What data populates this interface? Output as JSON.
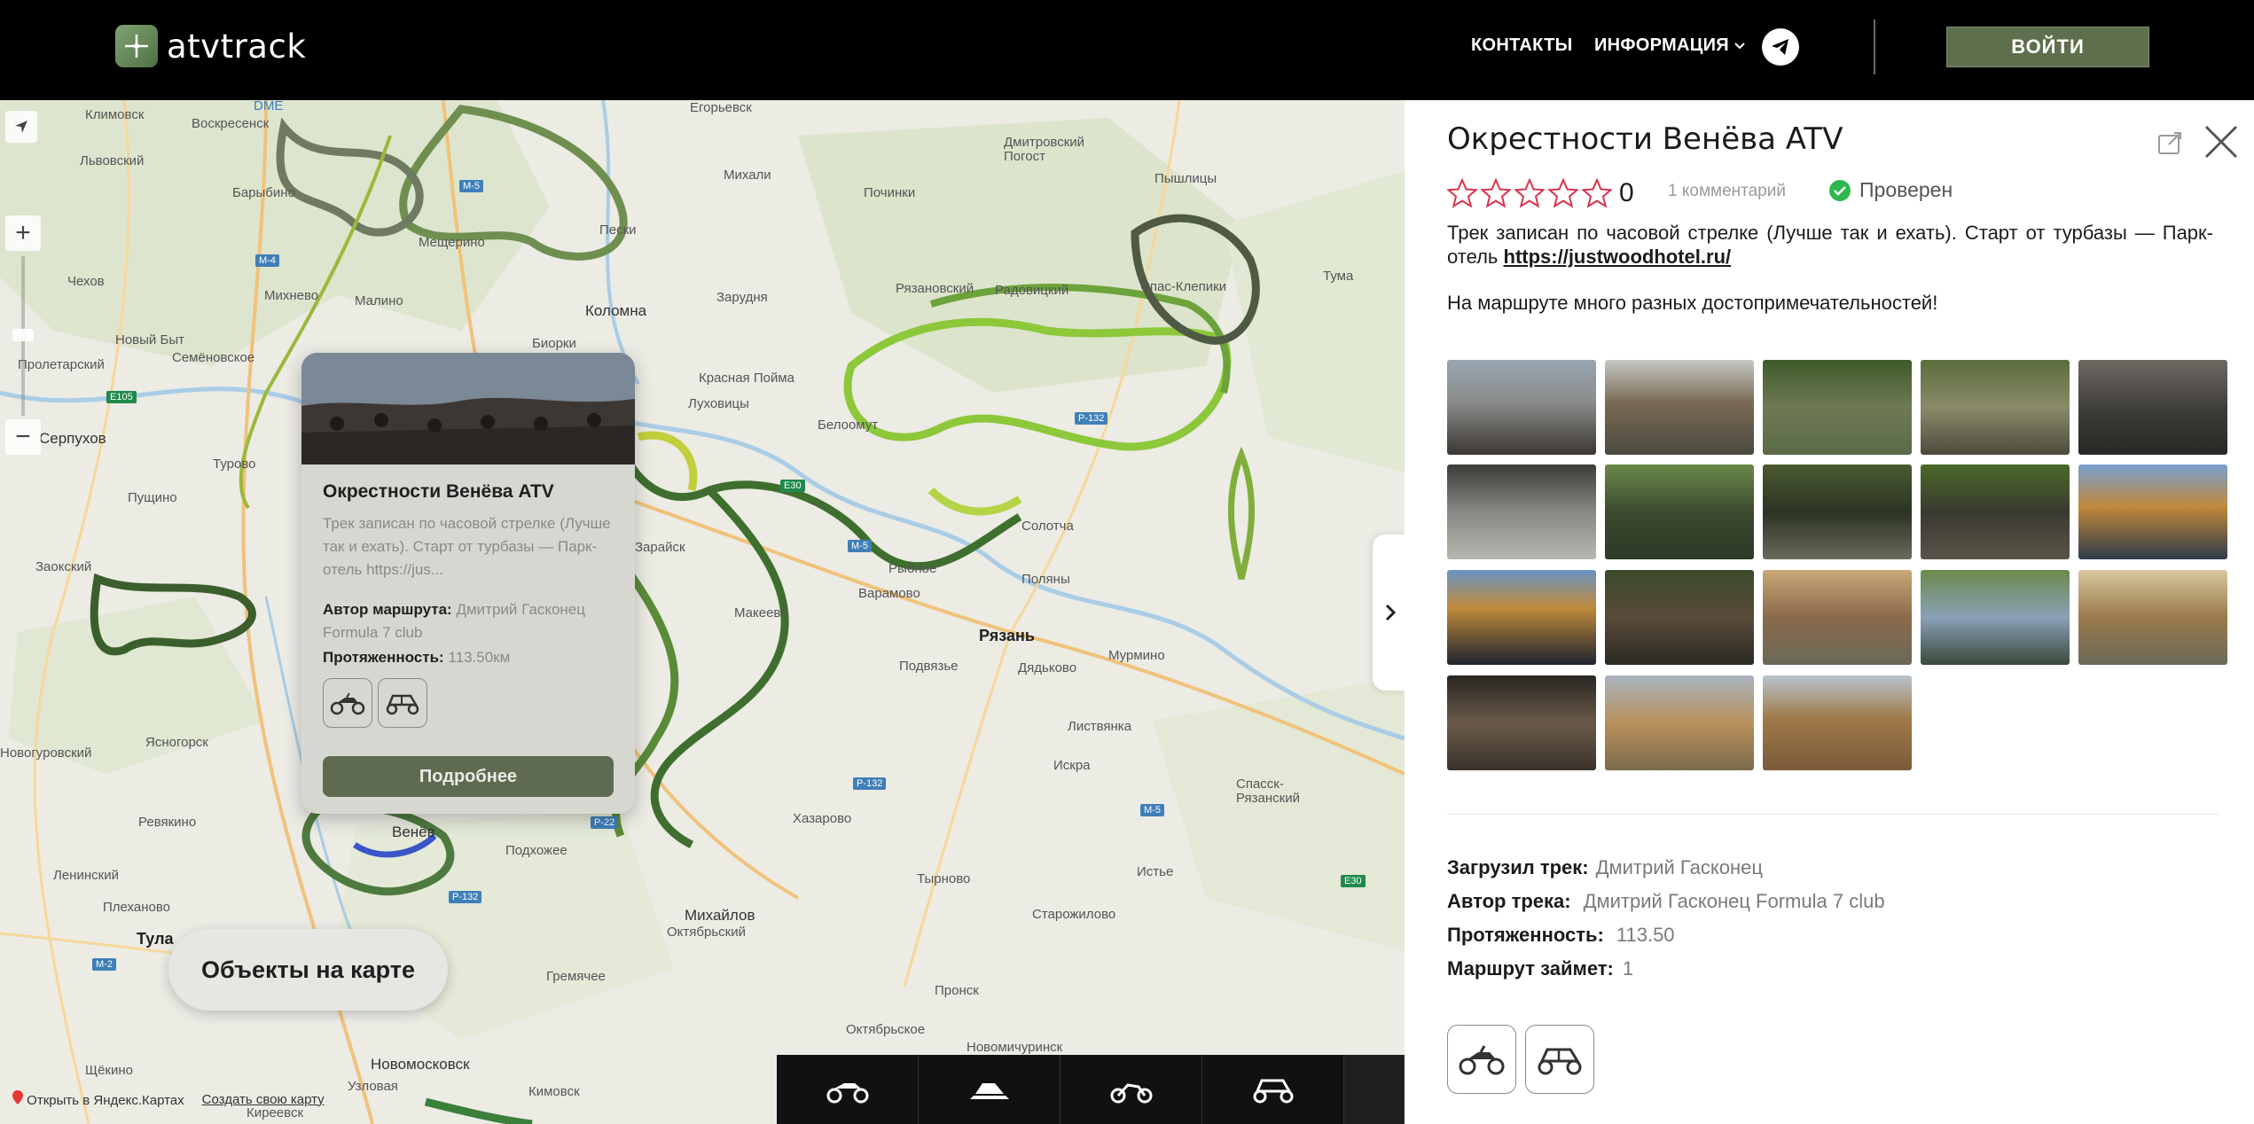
{
  "header": {
    "logo_text": "atvtrack",
    "nav": {
      "contacts": "КОНТАКТЫ",
      "info": "ИНФОРМАЦИЯ"
    },
    "login_label": "ВОЙТИ",
    "icons": [
      "logo-icon",
      "chevron-down-icon",
      "telegram-icon"
    ]
  },
  "map": {
    "labels": {
      "klimovsk": "Климовск",
      "voskresensk": "Воскресенск",
      "egorevsk": "Егорьевск",
      "lvovsky": "Львовский",
      "barybino": "Барыбино",
      "mikhali": "Михали",
      "dmitrovsky": "Дмитровский Погост",
      "pochinki": "Починки",
      "pyshlitsy": "Пышлицы",
      "mescherino": "Мещерино",
      "peski": "Пески",
      "chekhov": "Чехов",
      "mikhnevo": "Михнево",
      "malino": "Малино",
      "zaruzhe": "Зарудня",
      "kolomna": "Коломна",
      "ryazanovsky": "Рязановский",
      "radovitsky": "Радовицкий",
      "spas_klepiki": "Спас-Клепики",
      "tuma": "Тума",
      "novy_byt": "Новый Быт",
      "semenovskoe": "Семёновское",
      "biorki": "Биорки",
      "proletarsky": "Пролетарский",
      "krasnaya_poyma": "Красная Пойма",
      "lukhovitsy": "Луховицы",
      "serpukhov": "Серпухов",
      "belo": "Белоомут",
      "turovo": "Турово",
      "pushchino": "Пущино",
      "zaoksky": "Заокский",
      "zaraysk": "Зарайск",
      "solotcha": "Солотча",
      "rybnoe": "Рыбное",
      "biryamovo": "Варамово",
      "polyany": "Поляны",
      "makeevo": "Макеево",
      "ryazan": "Рязань",
      "podvyaze": "Подвязье",
      "dyadkovo": "Дядьково",
      "murmino": "Мурмино",
      "yasnogorsk": "Ясногорск",
      "novogurovsky": "Новогуровский",
      "listvyanka": "Листвянка",
      "iskra": "Искра",
      "spassk": "Спасск-Рязанский",
      "revyakino": "Ревякино",
      "venev": "Венёв",
      "podkhozhee": "Подхожее",
      "khazarovo": "Хазарово",
      "leninsky": "Ленинский",
      "plekhanovo": "Плеханово",
      "tula": "Тула",
      "tyrnovo": "Тырново",
      "istye": "Истье",
      "mikhailov": "Михайлов",
      "oktyabrsky": "Октябрьский",
      "starozhilovo": "Старожилово",
      "gremyachee": "Гремячее",
      "pronsk": "Пронск",
      "shchekino": "Щёкино",
      "novomoskovsk": "Новомосковск",
      "kimovsk": "Кимовск",
      "uzlovaya": "Узловая",
      "kireevsk": "Киреевск",
      "oktyabrskoe": "Октябрьское",
      "novomichurinsk": "Новомичуринск",
      "dme": "DME"
    },
    "road_badges": {
      "m5a": "M-5",
      "m4": "M-4",
      "e105": "E105",
      "e30": "E30",
      "m5b": "M-5",
      "p132a": "P-132",
      "p132b": "P-132",
      "p22": "P-22",
      "p132c": "P-132",
      "m5c": "M-5",
      "e30b": "E30",
      "m2": "M-2"
    },
    "popup": {
      "title": "Окрестности Венёва ATV",
      "description": "Трек записан по часовой стрелке (Лучше так и ехать). Старт от турбазы — Парк-отель https://jus...",
      "author_label": "Автор маршрута:",
      "author_value": "Дмитрий Гасконец Formula 7 club",
      "length_label": "Протяженность:",
      "length_value": "113.50км",
      "button_label": "Подробнее"
    },
    "objects_button": "Объекты на карте",
    "footer": {
      "open_yandex": "Открыть в Яндекс.Картах",
      "create_map": "Создать свою карту"
    }
  },
  "panel": {
    "title": "Окрестности Венёва ATV",
    "rating": {
      "stars": 0,
      "max": 5,
      "value": "0"
    },
    "comments": "1 комментарий",
    "verified": "Проверен",
    "description_text": "Трек записан по часовой стрелке (Лучше так и ехать). Старт от турбазы — Парк-отель ",
    "description_link": "https://justwoodhotel.ru/",
    "description2": "На маршруте много разных достопримечательностей!",
    "info": {
      "uploaded_label": "Загрузил трек:",
      "uploaded_value": "Дмитрий Гасконец",
      "author_label": "Автор трека:",
      "author_value": "Дмитрий Гасконец Formula 7 club",
      "length_label": "Протяженность:",
      "length_value": "113.50",
      "duration_label": "Маршрут займет:",
      "duration_value": "1"
    },
    "vehicles": [
      "atv-icon",
      "buggy-icon"
    ]
  },
  "colors": {
    "accent_green": "#5d6f4c",
    "verified_green": "#2db84e",
    "star_red": "#d9334f"
  }
}
